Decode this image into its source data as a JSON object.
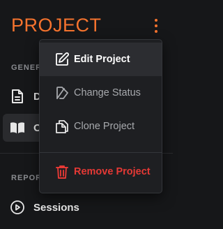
{
  "header": {
    "title": "PROJECT",
    "menu_icon": "kebab-vertical-icon",
    "accent_color": "#f5732e"
  },
  "sidebar": {
    "sections": [
      {
        "label": "GENER"
      },
      {
        "label": "REPOR"
      }
    ],
    "items": [
      {
        "label": "D",
        "icon": "document-icon",
        "active": false
      },
      {
        "label": "O",
        "icon": "book-icon",
        "active": true
      },
      {
        "label": "Sessions",
        "icon": "play-circle-icon",
        "active": false
      }
    ]
  },
  "dropdown": {
    "items": [
      {
        "label": "Edit Project",
        "icon": "edit-square-pen-icon",
        "state": "hover"
      },
      {
        "label": "Change Status",
        "icon": "status-slash-icon",
        "state": "muted"
      },
      {
        "label": "Clone Project",
        "icon": "copy-pages-icon",
        "state": "muted"
      },
      {
        "label": "Remove Project",
        "icon": "trash-icon",
        "state": "danger"
      }
    ],
    "danger_color": "#e53935"
  }
}
